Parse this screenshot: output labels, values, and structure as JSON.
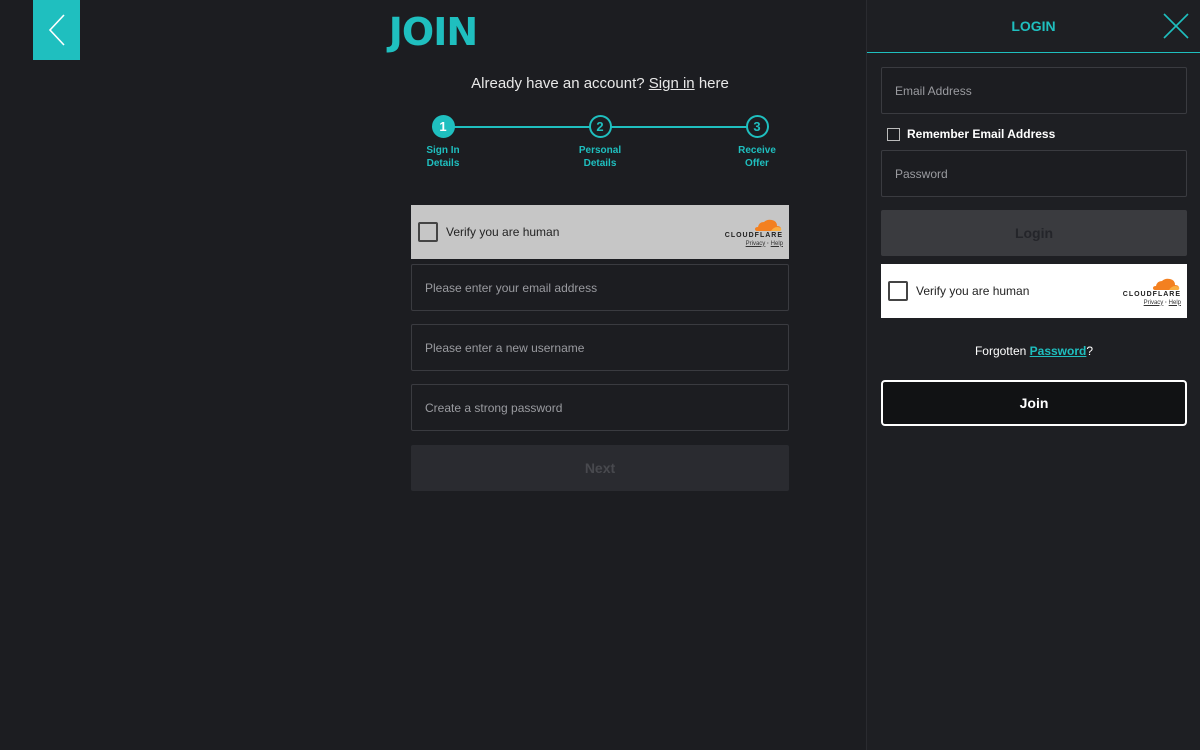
{
  "main": {
    "back_icon": "chevron-left-icon",
    "title": "JOIN",
    "already_prefix": "Already have an account?",
    "sign_in_link": "Sign in",
    "already_suffix": "here",
    "steps": [
      {
        "number": "1",
        "label_line1": "Sign In",
        "label_line2": "Details",
        "active": true
      },
      {
        "number": "2",
        "label_line1": "Personal",
        "label_line2": "Details",
        "active": false
      },
      {
        "number": "3",
        "label_line1": "Receive",
        "label_line2": "Offer",
        "active": false
      }
    ],
    "captcha": {
      "text": "Verify you are human",
      "brand": "CLOUDFLARE",
      "privacy": "Privacy",
      "separator": "·",
      "help": "Help"
    },
    "email_placeholder": "Please enter your email address",
    "username_placeholder": "Please enter a new username",
    "password_placeholder": "Create a strong password",
    "next_label": "Next"
  },
  "panel": {
    "title": "LOGIN",
    "close_icon": "close-icon",
    "email_placeholder": "Email Address",
    "remember_label": "Remember Email Address",
    "password_placeholder": "Password",
    "login_label": "Login",
    "captcha": {
      "text": "Verify you are human",
      "brand": "CLOUDFLARE",
      "privacy": "Privacy",
      "separator": "·",
      "help": "Help"
    },
    "forgot_prefix": "Forgotten",
    "forgot_link": "Password",
    "forgot_suffix": "?",
    "join_label": "Join"
  },
  "colors": {
    "accent": "#1fbfbf",
    "background": "#1c1d21",
    "cloudflare_orange": "#f38020"
  }
}
